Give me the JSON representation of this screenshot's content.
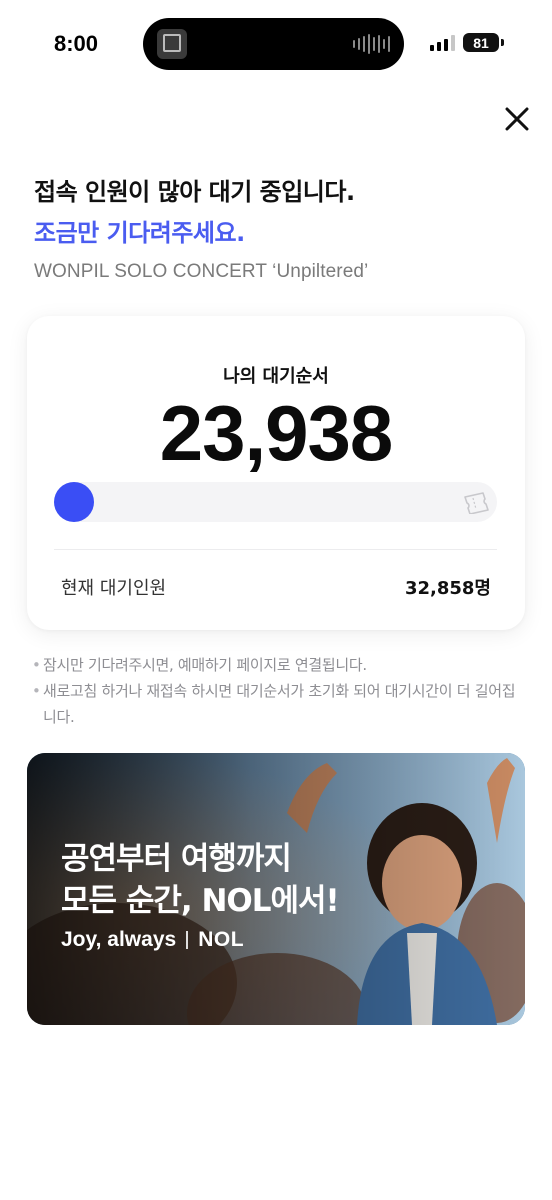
{
  "status_bar": {
    "time": "8:00",
    "battery": "81"
  },
  "header": {
    "title_line1": "접속 인원이 많아 대기 중입니다.",
    "title_line2": "조금만 기다려주세요.",
    "event_name": "WONPIL SOLO CONCERT ‘Unpiltered’"
  },
  "queue": {
    "position_label": "나의 대기순서",
    "position_value": "23,938",
    "progress": 0.0,
    "current_waiting_label": "현재 대기인원",
    "current_waiting_value": "32,858명"
  },
  "notices": [
    "잠시만 기다려주시면, 예매하기 페이지로 연결됩니다.",
    "새로고침 하거나 재접속 하시면 대기순서가 초기화 되어 대기시간이 더 길어집니다."
  ],
  "banner": {
    "line1": "공연부터 여행까지",
    "line2": "모든 순간, NOL에서!",
    "tagline": "Joy, always",
    "brand": "NOL"
  },
  "colors": {
    "accent": "#4a5cf0",
    "progress_knob": "#3a4ef5",
    "muted_text": "#8e8e93"
  },
  "icons": {
    "close": "close-icon",
    "ticket": "ticket-icon"
  }
}
